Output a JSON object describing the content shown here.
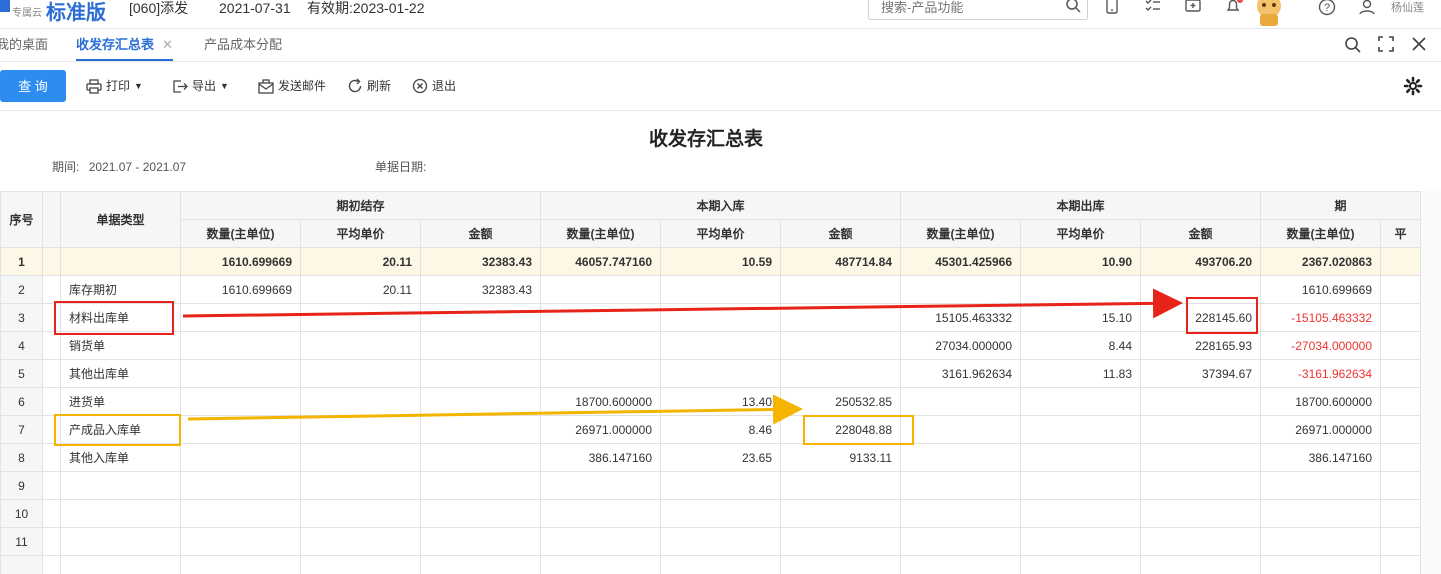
{
  "header": {
    "brand_sub": "专属云",
    "brand_name": "标准版",
    "company": "[060]添发",
    "date": "2021-07-31",
    "valid_label": "有效期:2023-01-22",
    "search_placeholder": "搜索-产品功能",
    "user_name": "杨仙莲"
  },
  "tabs": [
    {
      "label": "我的桌面"
    },
    {
      "label": "收发存汇总表",
      "active": true
    },
    {
      "label": "产品成本分配"
    }
  ],
  "toolbar": {
    "query_label": "查 询",
    "print_label": "打印",
    "export_label": "导出",
    "email_label": "发送邮件",
    "refresh_label": "刷新",
    "exit_label": "退出"
  },
  "report": {
    "title": "收发存汇总表",
    "period_label": "期间:",
    "period_value": "2021.07 - 2021.07",
    "doc_date_label": "单据日期:"
  },
  "table": {
    "col_index": "序号",
    "col_type": "单据类型",
    "groups": [
      "期初结存",
      "本期入库",
      "本期出库",
      "期"
    ],
    "sub_headers": [
      "数量(主单位)",
      "平均单价",
      "金额",
      "数量(主单位)",
      "平均单价",
      "金额",
      "数量(主单位)",
      "平均单价",
      "金额",
      "数量(主单位)",
      "平"
    ],
    "rows": [
      {
        "idx": "1",
        "type": "",
        "c": [
          "1610.699669",
          "20.11",
          "32383.43",
          "46057.747160",
          "10.59",
          "487714.84",
          "45301.425966",
          "10.90",
          "493706.20",
          "2367.020863",
          ""
        ]
      },
      {
        "idx": "2",
        "type": "库存期初",
        "c": [
          "1610.699669",
          "20.11",
          "32383.43",
          "",
          "",
          "",
          "",
          "",
          "",
          "1610.699669",
          ""
        ]
      },
      {
        "idx": "3",
        "type": "材料出库单",
        "c": [
          "",
          "",
          "",
          "",
          "",
          "",
          "15105.463332",
          "15.10",
          "228145.60",
          "-15105.463332",
          ""
        ]
      },
      {
        "idx": "4",
        "type": "销货单",
        "c": [
          "",
          "",
          "",
          "",
          "",
          "",
          "27034.000000",
          "8.44",
          "228165.93",
          "-27034.000000",
          ""
        ]
      },
      {
        "idx": "5",
        "type": "其他出库单",
        "c": [
          "",
          "",
          "",
          "",
          "",
          "",
          "3161.962634",
          "11.83",
          "37394.67",
          "-3161.962634",
          ""
        ]
      },
      {
        "idx": "6",
        "type": "进货单",
        "c": [
          "",
          "",
          "",
          "18700.600000",
          "13.40",
          "250532.85",
          "",
          "",
          "",
          "18700.600000",
          ""
        ]
      },
      {
        "idx": "7",
        "type": "产成品入库单",
        "c": [
          "",
          "",
          "",
          "26971.000000",
          "8.46",
          "228048.88",
          "",
          "",
          "",
          "26971.000000",
          ""
        ]
      },
      {
        "idx": "8",
        "type": "其他入库单",
        "c": [
          "",
          "",
          "",
          "386.147160",
          "23.65",
          "9133.11",
          "",
          "",
          "",
          "386.147160",
          ""
        ]
      },
      {
        "idx": "9",
        "type": "",
        "c": [
          "",
          "",
          "",
          "",
          "",
          "",
          "",
          "",
          "",
          "",
          ""
        ]
      },
      {
        "idx": "10",
        "type": "",
        "c": [
          "",
          "",
          "",
          "",
          "",
          "",
          "",
          "",
          "",
          "",
          ""
        ]
      },
      {
        "idx": "11",
        "type": "",
        "c": [
          "",
          "",
          "",
          "",
          "",
          "",
          "",
          "",
          "",
          "",
          ""
        ]
      },
      {
        "idx": "",
        "type": "",
        "c": [
          "",
          "",
          "",
          "",
          "",
          "",
          "",
          "",
          "",
          "",
          ""
        ]
      }
    ]
  },
  "colors": {
    "accent": "#2b6fd6",
    "primary_button": "#2d8cf0",
    "annotation_red": "#e8231a",
    "annotation_orange": "#f5b400",
    "negative_text": "#e33333"
  }
}
